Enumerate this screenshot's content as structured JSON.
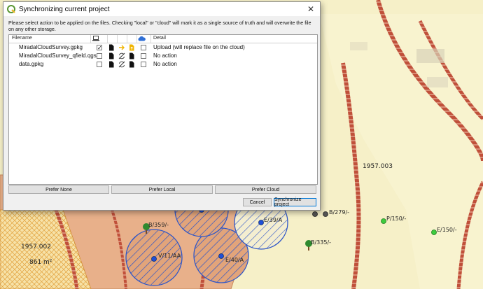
{
  "dialog": {
    "title": "Synchronizing current project",
    "close_glyph": "✕",
    "description": "Please select action to be applied on the files. Checking \"local\" or \"cloud\" will mark it as a single source of truth and will overwrite the file on any other storage.",
    "columns": {
      "filename": "Filename",
      "detail": "Detail",
      "local_icon": "laptop-icon",
      "cloud_icon": "cloud-icon"
    },
    "files": [
      {
        "name": "MiradalCloudSurvey.gpkg",
        "local_checked": true,
        "cloud_checked": false,
        "arrow": "arrow-right-icon",
        "detail": "Upload (will replace file on the cloud)"
      },
      {
        "name": "MiradalCloudSurvey_qfield.qgs",
        "local_checked": false,
        "cloud_checked": false,
        "arrow": "no-sync-icon",
        "detail": "No action"
      },
      {
        "name": "data.gpkg",
        "local_checked": false,
        "cloud_checked": false,
        "arrow": "no-sync-icon",
        "detail": "No action"
      }
    ],
    "buttons": {
      "prefer_none": "Prefer None",
      "prefer_local": "Prefer Local",
      "prefer_cloud": "Prefer Cloud",
      "cancel": "Cancel",
      "synchronize": "Synchronize project"
    },
    "colors": {
      "arrow": "#f0b400",
      "cloud": "#2f6fd6"
    }
  },
  "map": {
    "labels": {
      "parcel_a": "1957.002",
      "area": "861 m²",
      "parcel_b": "1957.003",
      "tree_a": "B/359/-",
      "tree_b": "B/335/-",
      "point_a": "V/11/AA",
      "point_b": "E/40/A",
      "point_c": "E/39/A",
      "point_d": "B/279/-",
      "point_e": "P/150/-",
      "point_f": "E/150/-"
    }
  }
}
